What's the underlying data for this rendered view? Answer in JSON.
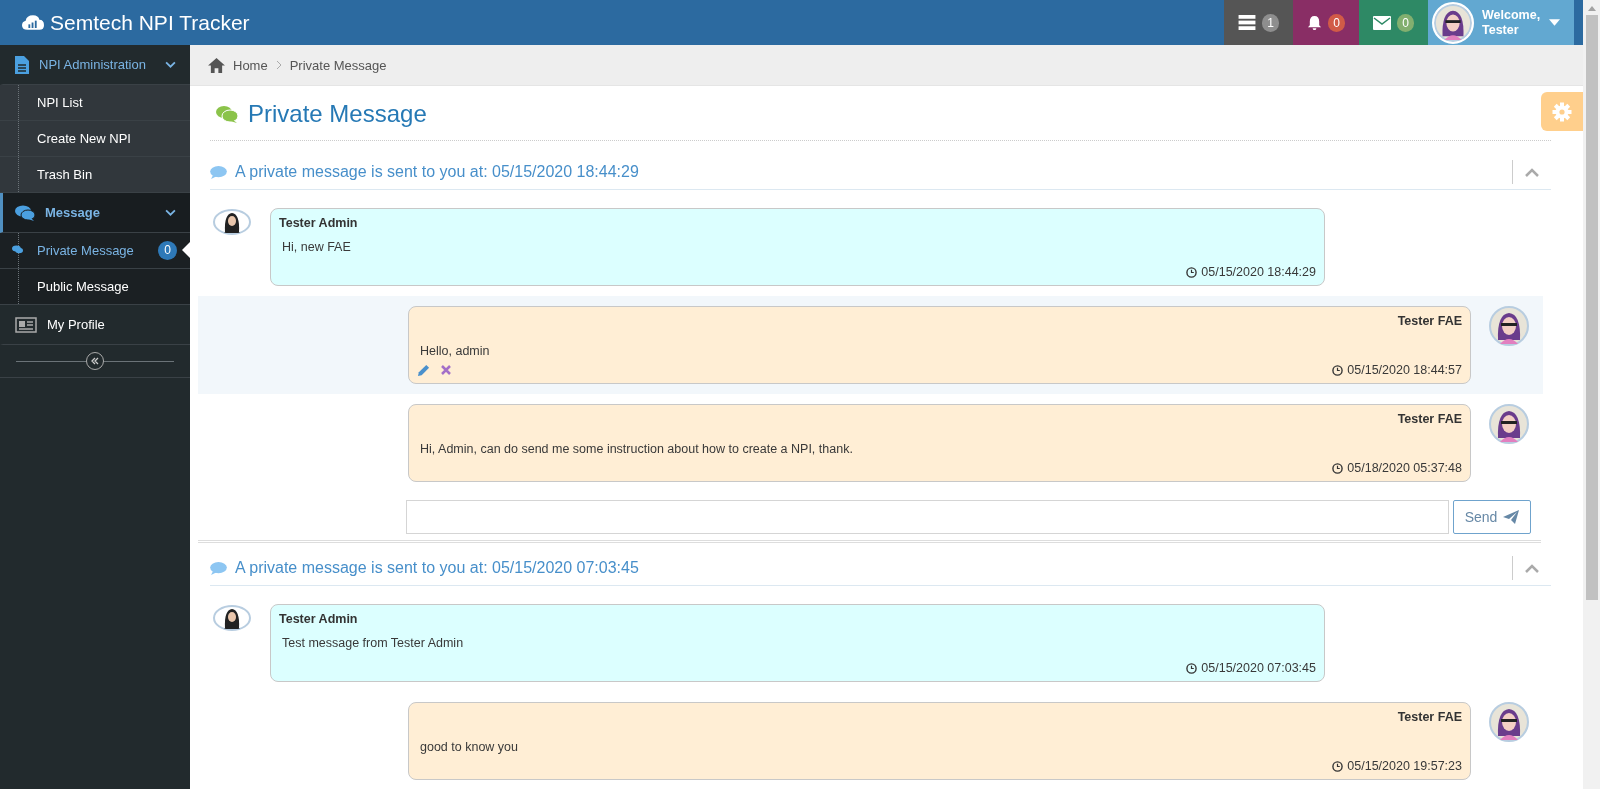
{
  "header": {
    "title": "Semtech NPI Tracker",
    "badges": [
      {
        "count": "1",
        "color": "#555555"
      },
      {
        "count": "0",
        "color": "#892e65"
      },
      {
        "count": "0",
        "color": "#2e8965"
      }
    ],
    "user": {
      "greeting": "Welcome,",
      "name": "Tester"
    }
  },
  "sidebar": {
    "items": [
      {
        "label": "NPI Administration",
        "expanded": true,
        "selected": false,
        "children": [
          {
            "label": "NPI List",
            "selected": false
          },
          {
            "label": "Create New NPI",
            "selected": false
          },
          {
            "label": "Trash Bin",
            "selected": false
          }
        ]
      },
      {
        "label": "Message",
        "expanded": true,
        "selected": true,
        "children": [
          {
            "label": "Private Message",
            "selected": true,
            "badge": "0"
          },
          {
            "label": "Public Message",
            "selected": false
          }
        ]
      },
      {
        "label": "My Profile",
        "selected": false
      }
    ]
  },
  "breadcrumb": [
    "Home",
    "Private Message"
  ],
  "page_title": "Private Message",
  "threads": [
    {
      "title": "A private message is sent to you at: 05/15/2020 18:44:29",
      "expanded": true,
      "messages": [
        {
          "kind": "received",
          "author": "Tester Admin",
          "text": "Hi, new FAE",
          "time": "05/15/2020 18:44:29",
          "hovered": false
        },
        {
          "kind": "sent",
          "author": "Tester FAE",
          "text": "Hello, admin",
          "time": "05/15/2020 18:44:57",
          "hovered": true
        },
        {
          "kind": "sent",
          "author": "Tester FAE",
          "text": "Hi, Admin, can do send me some instruction about how to create a NPI, thank.",
          "time": "05/18/2020 05:37:48",
          "hovered": false
        }
      ],
      "reply": {
        "button": "Send"
      }
    },
    {
      "title": "A private message is sent to you at: 05/15/2020 07:03:45",
      "expanded": true,
      "messages": [
        {
          "kind": "received",
          "author": "Tester Admin",
          "text": "Test message from Tester Admin",
          "time": "05/15/2020 07:03:45",
          "hovered": false
        },
        {
          "kind": "sent",
          "author": "Tester FAE",
          "text": "good to know you",
          "time": "05/15/2020 19:57:23",
          "hovered": false
        }
      ]
    }
  ]
}
